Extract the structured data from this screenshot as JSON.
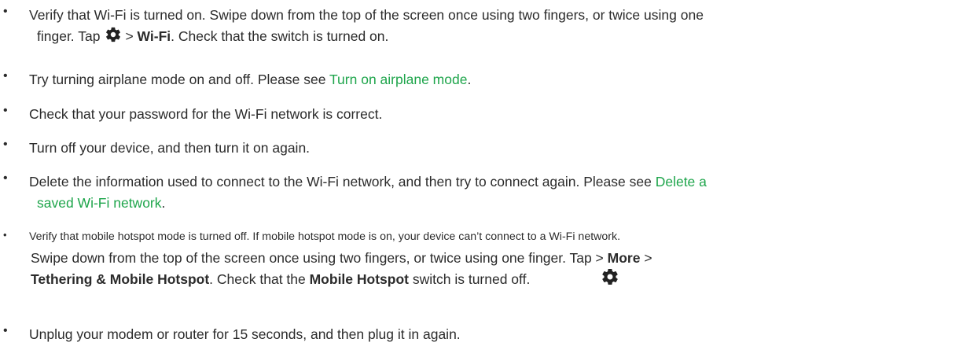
{
  "items": [
    {
      "l1_a": "Verify that Wi-Fi is turned on. Swipe down from the top of the screen once using two fingers, or twice using one",
      "l2_a": "finger. Tap",
      "l2_b": ">",
      "l2_bold": "Wi-Fi",
      "l2_c": ". Check that the switch is turned on."
    },
    {
      "a": "Try turning airplane mode on and off. Please see ",
      "link": "Turn on airplane mode",
      "b": "."
    },
    {
      "a": "Check that your password for the Wi-Fi network is correct."
    },
    {
      "a": "Turn off your device, and then turn it on again."
    },
    {
      "l1_a": "Delete the information used to connect to the Wi-Fi network, and then try to connect again. Please see ",
      "l1_link": "Delete a",
      "l2_link": "saved Wi-Fi network",
      "l2_b": "."
    },
    {
      "l1": "Verify that mobile hotspot mode is turned off. If mobile hotspot mode is on, your device can’t connect to a Wi-Fi network.",
      "l2_a": "Swipe down from the top of the screen once using two fingers, or twice using one finger. Tap > ",
      "l2_bold": "More",
      "l2_b": " >",
      "l3_bold1": "Tethering & Mobile Hotspot",
      "l3_a": ". Check that the ",
      "l3_bold2": "Mobile Hotspot",
      "l3_b": " switch is turned off."
    },
    {
      "a": "Unplug your modem or router for 15 seconds, and then plug it in again."
    }
  ],
  "bullet": "•",
  "icons": {
    "settings": "gear-icon"
  },
  "colors": {
    "text": "#2b2b2b",
    "link": "#1ea54b"
  }
}
